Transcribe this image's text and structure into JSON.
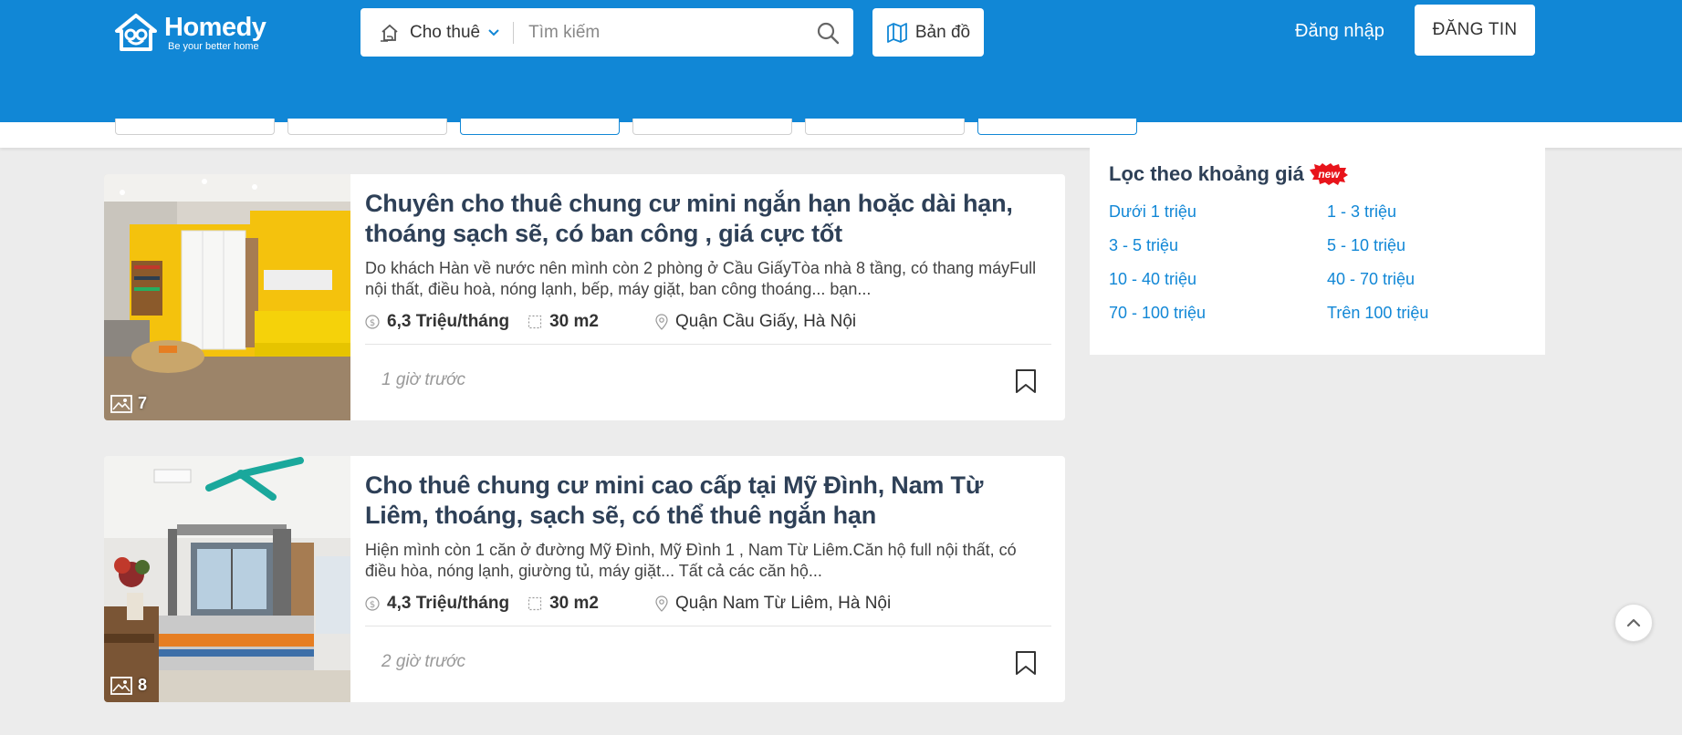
{
  "header": {
    "brand_name": "Homedy",
    "brand_tagline": "Be your better home",
    "search": {
      "type_label": "Cho thuê",
      "placeholder": "Tìm kiếm"
    },
    "map_label": "Bản đồ",
    "login_label": "Đăng nhập",
    "post_label": "ĐĂNG TIN"
  },
  "listings": [
    {
      "title": "Chuyên cho thuê chung cư mini ngắn hạn hoặc dài hạn, thoáng sạch sẽ, có ban công , giá cực tốt",
      "description": "Do khách Hàn về nước nên mình còn 2 phòng ở Cầu GiấyTòa nhà 8 tầng, có thang máyFull nội thất, điều hoà, nóng lạnh, bếp, máy giặt, ban công thoáng... bạn...",
      "price": "6,3 Triệu/tháng",
      "area": "30 m2",
      "location": "Quận Cầu Giấy, Hà Nội",
      "time": "1 giờ trước",
      "photo_count": "7"
    },
    {
      "title": "Cho thuê chung cư mini cao cấp tại Mỹ Đình, Nam Từ Liêm, thoáng, sạch sẽ, có thể thuê ngắn hạn",
      "description": "Hiện mình còn 1 căn ở đường Mỹ Đình, Mỹ Đình 1 , Nam Từ Liêm.Căn hộ full nội thất, có điều hòa, nóng lạnh, giường tủ, máy giặt... Tất cả các căn hộ...",
      "price": "4,3 Triệu/tháng",
      "area": "30 m2",
      "location": "Quận Nam Từ Liêm, Hà Nội",
      "time": "2 giờ trước",
      "photo_count": "8"
    }
  ],
  "price_filter": {
    "title": "Lọc theo khoảng giá",
    "badge": "new",
    "ranges": [
      "Dưới 1 triệu",
      "1 - 3 triệu",
      "3 - 5 triệu",
      "5 - 10 triệu",
      "10 - 40 triệu",
      "40 - 70 triệu",
      "70 - 100 triệu",
      "Trên 100 triệu"
    ]
  },
  "colors": {
    "brand_blue": "#1187d6",
    "title_navy": "#2e4057",
    "page_bg": "#ececec"
  },
  "icons": [
    "logo-house-icon",
    "home-type-icon",
    "chevron-down-icon",
    "search-icon",
    "map-icon",
    "photo-icon",
    "price-icon",
    "area-icon",
    "location-pin-icon",
    "bookmark-icon",
    "new-badge-icon",
    "chevron-up-icon"
  ]
}
